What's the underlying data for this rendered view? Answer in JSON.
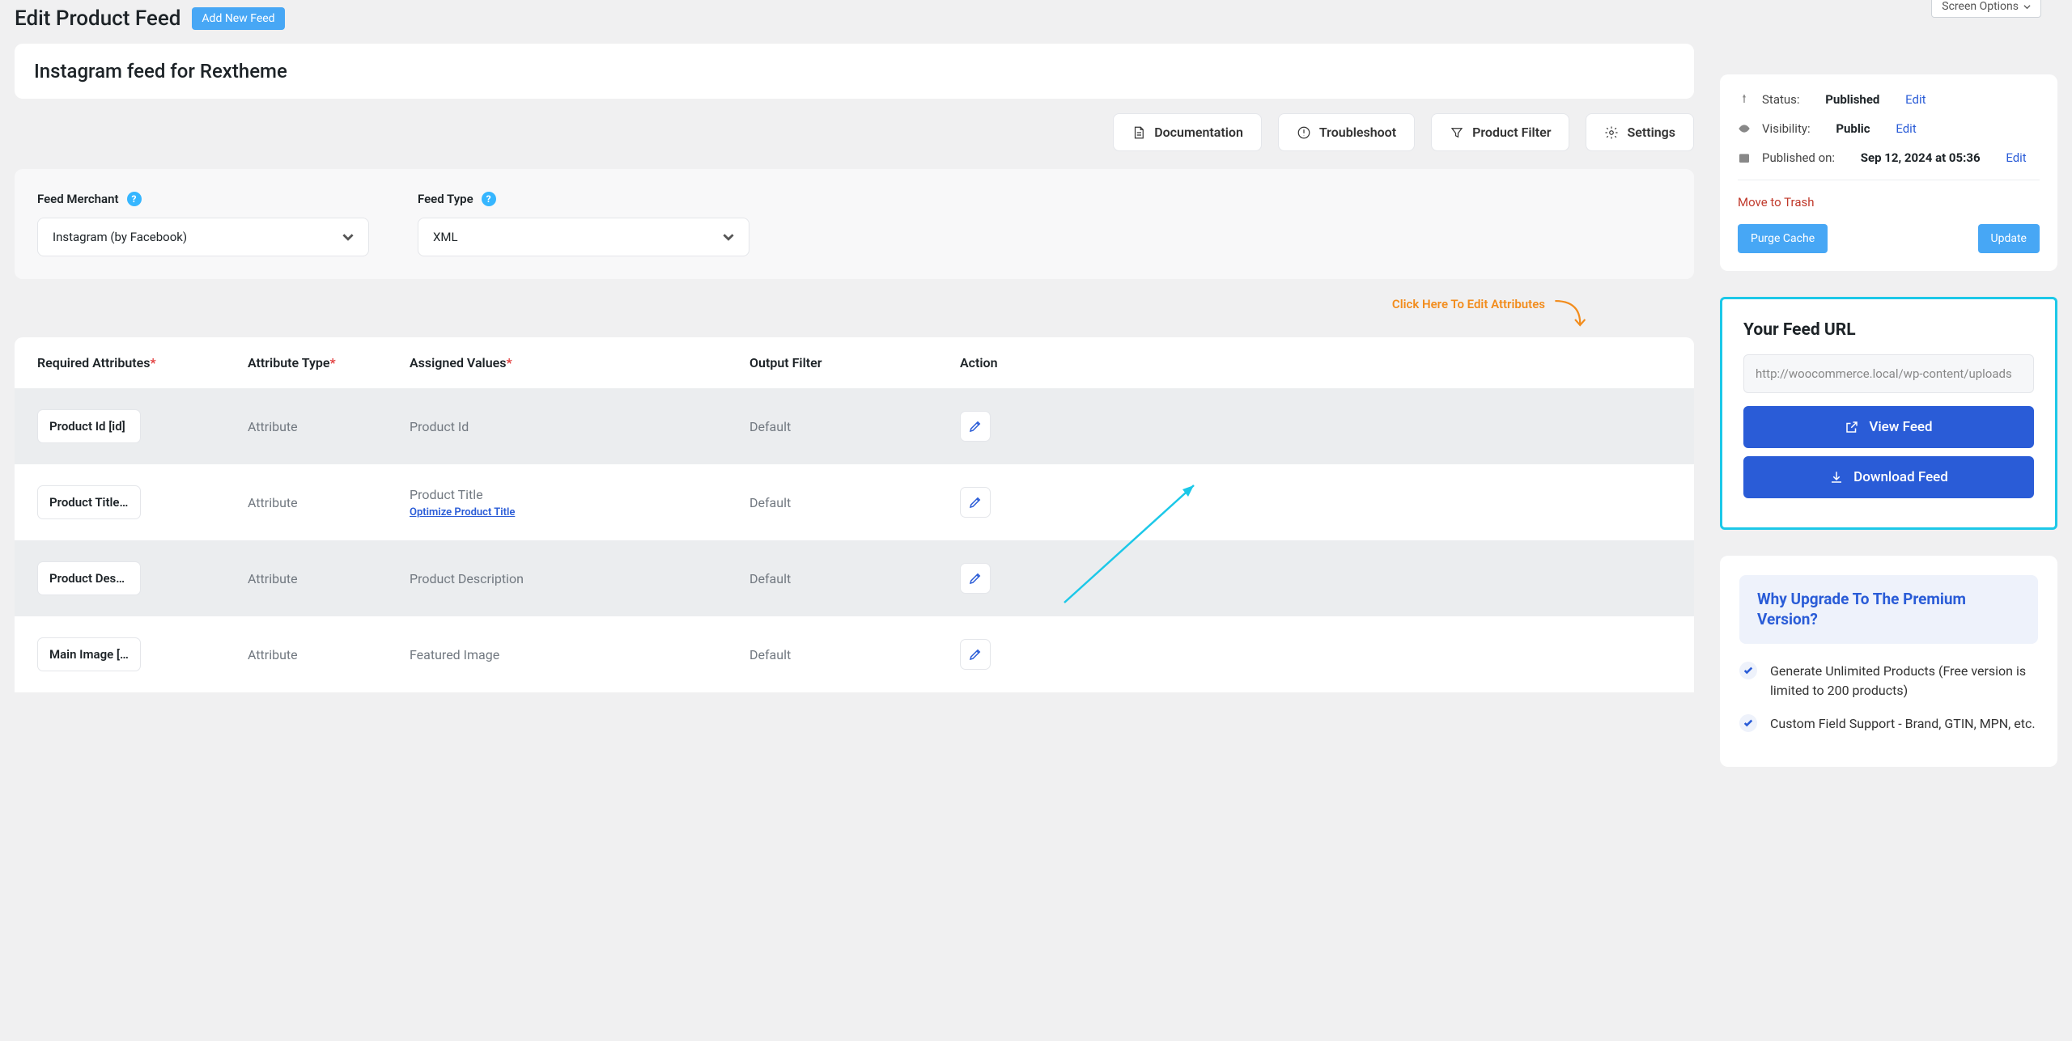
{
  "header": {
    "page_title": "Edit Product Feed",
    "add_new_label": "Add New Feed",
    "screen_options_label": "Screen Options"
  },
  "feed": {
    "title": "Instagram feed for Rextheme"
  },
  "toolbar": {
    "documentation": "Documentation",
    "troubleshoot": "Troubleshoot",
    "product_filter": "Product Filter",
    "settings": "Settings"
  },
  "merchant": {
    "feed_merchant_label": "Feed Merchant",
    "feed_merchant_value": "Instagram (by Facebook)",
    "feed_type_label": "Feed Type",
    "feed_type_value": "XML"
  },
  "edit_attributes_hint": "Click Here To Edit Attributes",
  "columns": {
    "c1": "Required Attributes",
    "c2": "Attribute Type",
    "c3": "Assigned Values",
    "c4": "Output Filter",
    "c5": "Action"
  },
  "optimize_link": "Optimize Product Title",
  "rows": [
    {
      "name": "Product Id [id]",
      "type": "Attribute",
      "value": "Product Id",
      "filter": "Default",
      "opt_link": false
    },
    {
      "name": "Product Title …",
      "type": "Attribute",
      "value": "Product Title",
      "filter": "Default",
      "opt_link": true
    },
    {
      "name": "Product Desc…",
      "type": "Attribute",
      "value": "Product Description",
      "filter": "Default",
      "opt_link": false
    },
    {
      "name": "Main Image […",
      "type": "Attribute",
      "value": "Featured Image",
      "filter": "Default",
      "opt_link": false
    }
  ],
  "publish": {
    "status_label": "Status:",
    "status_value": "Published",
    "visibility_label": "Visibility:",
    "visibility_value": "Public",
    "published_on_label": "Published on:",
    "published_on_value": "Sep 12, 2024 at 05:36",
    "edit_link": "Edit",
    "trash_link": "Move to Trash",
    "purge_label": "Purge Cache",
    "update_label": "Update"
  },
  "feed_url": {
    "title": "Your Feed URL",
    "value": "http://woocommerce.local/wp-content/uploads",
    "view_label": "View Feed",
    "download_label": "Download Feed"
  },
  "upgrade": {
    "title": "Why Upgrade To The Premium Version?",
    "items": [
      "Generate Unlimited Products (Free version is limited to 200 products)",
      "Custom Field Support - Brand, GTIN, MPN, etc."
    ]
  }
}
